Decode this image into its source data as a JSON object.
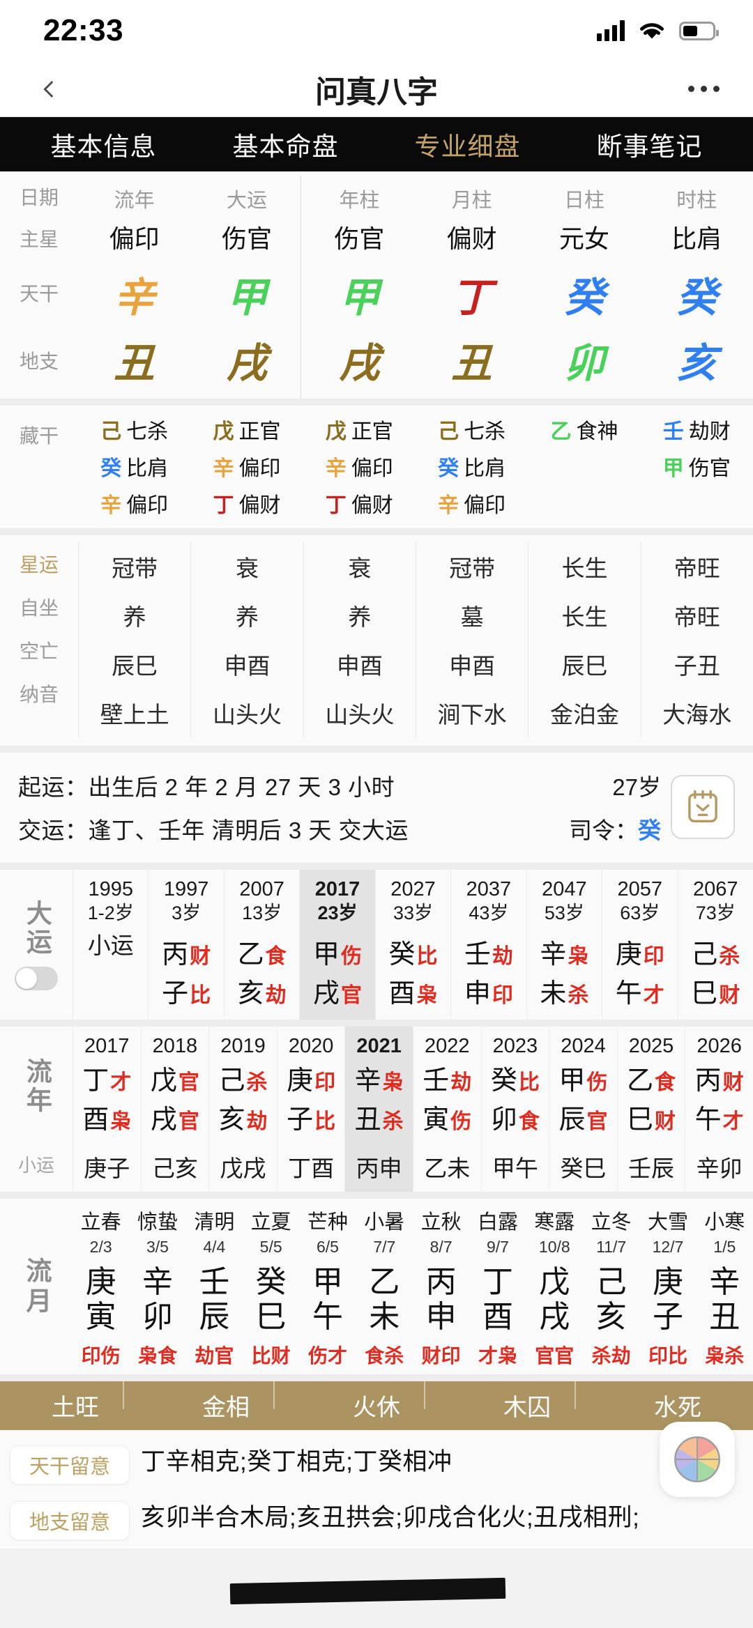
{
  "statusbar": {
    "time": "22:33",
    "signal_icon": "cellular-signal-icon",
    "wifi_icon": "wifi-icon",
    "battery_icon": "battery-icon"
  },
  "navbar": {
    "back_icon": "chevron-left-icon",
    "title": "问真八字",
    "more_icon": "more-horizontal-icon"
  },
  "tabs": [
    {
      "label": "基本信息",
      "active": false
    },
    {
      "label": "基本命盘",
      "active": false
    },
    {
      "label": "专业细盘",
      "active": true
    },
    {
      "label": "断事笔记",
      "active": false
    }
  ],
  "accent_gold": "#c2a268",
  "pillars": {
    "row_labels": {
      "date": "日期",
      "main_star": "主星",
      "heaven_stem": "天干",
      "earth_branch": "地支",
      "hidden": "藏干"
    },
    "columns": [
      "流年",
      "大运",
      "年柱",
      "月柱",
      "日柱",
      "时柱"
    ],
    "main_stars": [
      "偏印",
      "伤官",
      "伤官",
      "偏财",
      "元女",
      "比肩"
    ],
    "stems": [
      {
        "char": "辛",
        "element": "metal"
      },
      {
        "char": "甲",
        "element": "wood"
      },
      {
        "char": "甲",
        "element": "wood"
      },
      {
        "char": "丁",
        "element": "fire"
      },
      {
        "char": "癸",
        "element": "water"
      },
      {
        "char": "癸",
        "element": "water"
      }
    ],
    "branches": [
      {
        "char": "丑",
        "element": "earth"
      },
      {
        "char": "戌",
        "element": "earth"
      },
      {
        "char": "戌",
        "element": "earth"
      },
      {
        "char": "丑",
        "element": "earth"
      },
      {
        "char": "卯",
        "element": "wood"
      },
      {
        "char": "亥",
        "element": "water"
      }
    ],
    "hidden_stems": [
      [
        {
          "g": "己",
          "e": "earth",
          "t": "七杀"
        },
        {
          "g": "癸",
          "e": "water",
          "t": "比肩"
        },
        {
          "g": "辛",
          "e": "metal",
          "t": "偏印"
        }
      ],
      [
        {
          "g": "戊",
          "e": "earth",
          "t": "正官"
        },
        {
          "g": "辛",
          "e": "metal",
          "t": "偏印"
        },
        {
          "g": "丁",
          "e": "fire",
          "t": "偏财"
        }
      ],
      [
        {
          "g": "戊",
          "e": "earth",
          "t": "正官"
        },
        {
          "g": "辛",
          "e": "metal",
          "t": "偏印"
        },
        {
          "g": "丁",
          "e": "fire",
          "t": "偏财"
        }
      ],
      [
        {
          "g": "己",
          "e": "earth",
          "t": "七杀"
        },
        {
          "g": "癸",
          "e": "water",
          "t": "比肩"
        },
        {
          "g": "辛",
          "e": "metal",
          "t": "偏印"
        }
      ],
      [
        {
          "g": "乙",
          "e": "wood",
          "t": "食神"
        }
      ],
      [
        {
          "g": "壬",
          "e": "water",
          "t": "劫财"
        },
        {
          "g": "甲",
          "e": "wood",
          "t": "伤官"
        }
      ]
    ]
  },
  "four_rows": {
    "labels": [
      "星运",
      "自坐",
      "空亡",
      "纳音"
    ],
    "xingyun": [
      "冠带",
      "衰",
      "衰",
      "冠带",
      "长生",
      "帝旺"
    ],
    "zizuo": [
      "养",
      "养",
      "养",
      "墓",
      "长生",
      "帝旺"
    ],
    "kongwang": [
      "辰巳",
      "申酉",
      "申酉",
      "申酉",
      "辰巳",
      "子丑"
    ],
    "nayin": [
      "壁上土",
      "山头火",
      "山头火",
      "涧下水",
      "金泊金",
      "大海水"
    ]
  },
  "qiyun": {
    "line1_label": "起运：",
    "line1_value": "出生后 2 年 2 月 27 天 3 小时",
    "line2_label": "交运：",
    "line2_value": "逢丁、壬年 清明后 3 天 交大运",
    "age": "27岁",
    "siling_label": "司令：",
    "siling_value": "癸",
    "calendar_icon": "today-calendar-icon"
  },
  "dayun": {
    "title": "大运",
    "toggle_icon": "toggle-switch-off",
    "columns": [
      {
        "year": "1995",
        "age": "1-2岁",
        "selected": false,
        "is_xiaoyun": true,
        "xiaoyun_text": "小运"
      },
      {
        "year": "1997",
        "age": "3岁",
        "selected": false,
        "stem": "丙",
        "stem_rel": "财",
        "branch": "子",
        "branch_rel": "比"
      },
      {
        "year": "2007",
        "age": "13岁",
        "selected": false,
        "stem": "乙",
        "stem_rel": "食",
        "branch": "亥",
        "branch_rel": "劫"
      },
      {
        "year": "2017",
        "age": "23岁",
        "selected": true,
        "stem": "甲",
        "stem_rel": "伤",
        "branch": "戌",
        "branch_rel": "官"
      },
      {
        "year": "2027",
        "age": "33岁",
        "selected": false,
        "stem": "癸",
        "stem_rel": "比",
        "branch": "酉",
        "branch_rel": "枭"
      },
      {
        "year": "2037",
        "age": "43岁",
        "selected": false,
        "stem": "壬",
        "stem_rel": "劫",
        "branch": "申",
        "branch_rel": "印"
      },
      {
        "year": "2047",
        "age": "53岁",
        "selected": false,
        "stem": "辛",
        "stem_rel": "枭",
        "branch": "未",
        "branch_rel": "杀"
      },
      {
        "year": "2057",
        "age": "63岁",
        "selected": false,
        "stem": "庚",
        "stem_rel": "印",
        "branch": "午",
        "branch_rel": "才"
      },
      {
        "year": "2067",
        "age": "73岁",
        "selected": false,
        "stem": "己",
        "stem_rel": "杀",
        "branch": "巳",
        "branch_rel": "财"
      }
    ]
  },
  "liunian": {
    "title": "流年",
    "sub_label": "小运",
    "columns": [
      {
        "year": "2017",
        "selected": false,
        "stem": "丁",
        "stem_rel": "才",
        "branch": "酉",
        "branch_rel": "枭",
        "xiaoyun": "庚子"
      },
      {
        "year": "2018",
        "selected": false,
        "stem": "戊",
        "stem_rel": "官",
        "branch": "戌",
        "branch_rel": "官",
        "xiaoyun": "己亥"
      },
      {
        "year": "2019",
        "selected": false,
        "stem": "己",
        "stem_rel": "杀",
        "branch": "亥",
        "branch_rel": "劫",
        "xiaoyun": "戊戌"
      },
      {
        "year": "2020",
        "selected": false,
        "stem": "庚",
        "stem_rel": "印",
        "branch": "子",
        "branch_rel": "比",
        "xiaoyun": "丁酉"
      },
      {
        "year": "2021",
        "selected": true,
        "stem": "辛",
        "stem_rel": "枭",
        "branch": "丑",
        "branch_rel": "杀",
        "xiaoyun": "丙申"
      },
      {
        "year": "2022",
        "selected": false,
        "stem": "壬",
        "stem_rel": "劫",
        "branch": "寅",
        "branch_rel": "伤",
        "xiaoyun": "乙未"
      },
      {
        "year": "2023",
        "selected": false,
        "stem": "癸",
        "stem_rel": "比",
        "branch": "卯",
        "branch_rel": "食",
        "xiaoyun": "甲午"
      },
      {
        "year": "2024",
        "selected": false,
        "stem": "甲",
        "stem_rel": "伤",
        "branch": "辰",
        "branch_rel": "官",
        "xiaoyun": "癸巳"
      },
      {
        "year": "2025",
        "selected": false,
        "stem": "乙",
        "stem_rel": "食",
        "branch": "巳",
        "branch_rel": "财",
        "xiaoyun": "壬辰"
      },
      {
        "year": "2026",
        "selected": false,
        "stem": "丙",
        "stem_rel": "财",
        "branch": "午",
        "branch_rel": "才",
        "xiaoyun": "辛卯"
      }
    ]
  },
  "liuyue": {
    "title": "流月",
    "columns": [
      {
        "jieqi": "立春",
        "date": "2/3",
        "stem": "庚",
        "branch": "寅",
        "rel": "印伤"
      },
      {
        "jieqi": "惊蛰",
        "date": "3/5",
        "stem": "辛",
        "branch": "卯",
        "rel": "枭食"
      },
      {
        "jieqi": "清明",
        "date": "4/4",
        "stem": "壬",
        "branch": "辰",
        "rel": "劫官"
      },
      {
        "jieqi": "立夏",
        "date": "5/5",
        "stem": "癸",
        "branch": "巳",
        "rel": "比财"
      },
      {
        "jieqi": "芒种",
        "date": "6/5",
        "stem": "甲",
        "branch": "午",
        "rel": "伤才"
      },
      {
        "jieqi": "小暑",
        "date": "7/7",
        "stem": "乙",
        "branch": "未",
        "rel": "食杀"
      },
      {
        "jieqi": "立秋",
        "date": "8/7",
        "stem": "丙",
        "branch": "申",
        "rel": "财印"
      },
      {
        "jieqi": "白露",
        "date": "9/7",
        "stem": "丁",
        "branch": "酉",
        "rel": "才枭"
      },
      {
        "jieqi": "寒露",
        "date": "10/8",
        "stem": "戊",
        "branch": "戌",
        "rel": "官官"
      },
      {
        "jieqi": "立冬",
        "date": "11/7",
        "stem": "己",
        "branch": "亥",
        "rel": "杀劫"
      },
      {
        "jieqi": "大雪",
        "date": "12/7",
        "stem": "庚",
        "branch": "子",
        "rel": "印比"
      },
      {
        "jieqi": "小寒",
        "date": "1/5",
        "stem": "辛",
        "branch": "丑",
        "rel": "枭杀"
      }
    ]
  },
  "wuxing": [
    "土旺",
    "金相",
    "火休",
    "木囚",
    "水死"
  ],
  "notes": [
    {
      "chip": "天干留意",
      "text": "丁辛相克;癸丁相克;丁癸相冲"
    },
    {
      "chip": "地支留意",
      "text": "亥卯半合木局;亥丑拱会;卯戌合化火;丑戌相刑;"
    }
  ],
  "fab": {
    "icon": "compass-color-icon"
  }
}
